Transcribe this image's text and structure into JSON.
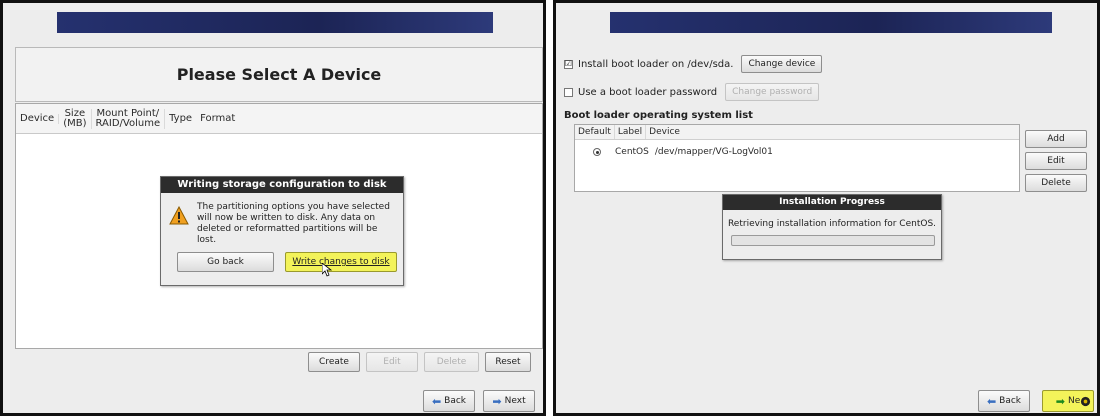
{
  "left": {
    "title": "Please Select A Device",
    "columns": [
      "Device",
      "Size\n(MB)",
      "Mount Point/\nRAID/Volume",
      "Type",
      "Format"
    ],
    "dialog": {
      "title": "Writing storage configuration to disk",
      "message": "The partitioning options you have selected will now be written to disk.  Any data on deleted or reformatted partitions will be lost.",
      "go_back_label": "Go back",
      "write_label": "Write changes to disk"
    },
    "actions": {
      "create": "Create",
      "edit": "Edit",
      "delete": "Delete",
      "reset": "Reset"
    },
    "nav": {
      "back": "Back",
      "next": "Next"
    }
  },
  "right": {
    "install_label": "Install boot loader on /dev/sda.",
    "install_checked": "☑",
    "change_device": "Change device",
    "password_label": "Use a boot loader password",
    "change_password": "Change password",
    "list_title": "Boot loader operating system list",
    "list_columns": {
      "default": "Default",
      "label": "Label",
      "device": "Device"
    },
    "os_entry": {
      "label": "CentOS",
      "device": "/dev/mapper/VG-LogVol01"
    },
    "buttons": {
      "add": "Add",
      "edit": "Edit",
      "delete": "Delete"
    },
    "progress": {
      "title": "Installation Progress",
      "status": "Retrieving installation information for CentOS.",
      "fraction": 0
    },
    "nav": {
      "back": "Back",
      "next": "Ne"
    }
  },
  "colors": {
    "banner": "#1f2a63",
    "highlight": "#f3f35a",
    "dialog_title_bg": "#2c2c2c"
  },
  "icons": [
    "warning-icon",
    "back-arrow-icon",
    "next-arrow-icon",
    "mouse-cursor-icon"
  ]
}
